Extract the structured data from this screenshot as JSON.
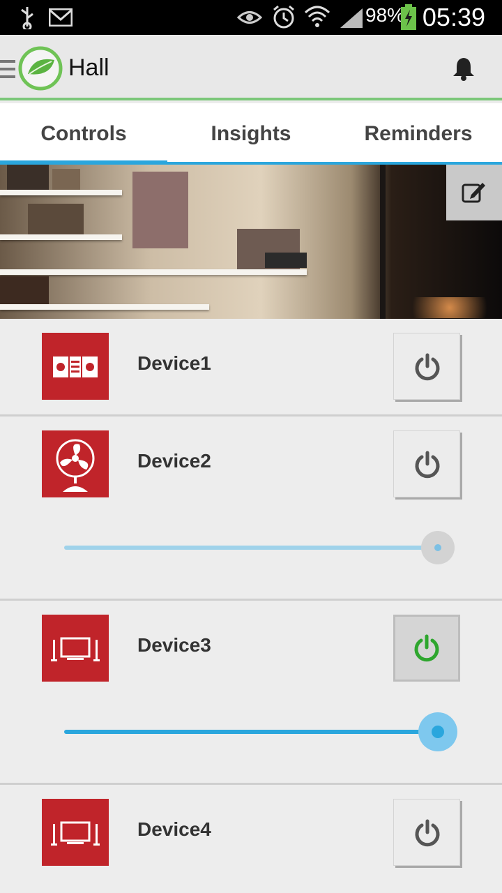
{
  "status_bar": {
    "battery": "98%",
    "time": "05:39",
    "icons": [
      "usb-icon",
      "gmail-icon",
      "eye-icon",
      "alarm-icon",
      "wifi-icon",
      "signal-icon",
      "battery-icon"
    ]
  },
  "appbar": {
    "title": "Hall",
    "icons": [
      "menu-icon",
      "leaf-logo",
      "bell-icon"
    ]
  },
  "tabs": [
    {
      "label": "Controls",
      "active": true
    },
    {
      "label": "Insights",
      "active": false
    },
    {
      "label": "Reminders",
      "active": false
    }
  ],
  "hero": {
    "edit_icon": "edit-icon"
  },
  "devices": [
    {
      "name": "Device1",
      "icon": "stereo-icon",
      "power": "off",
      "slider": null
    },
    {
      "name": "Device2",
      "icon": "fan-icon",
      "power": "off",
      "slider": {
        "value": 1.0,
        "enabled": false
      }
    },
    {
      "name": "Device3",
      "icon": "tv-icon",
      "power": "on",
      "slider": {
        "value": 1.0,
        "enabled": true
      }
    },
    {
      "name": "Device4",
      "icon": "tv-icon",
      "power": "off",
      "slider": null
    }
  ],
  "colors": {
    "accent": "#2aa6dd",
    "device_icon_bg": "#c0242a",
    "power_on": "#2ea62e",
    "power_off": "#555555",
    "appbar_underline": "#7cc77a"
  }
}
